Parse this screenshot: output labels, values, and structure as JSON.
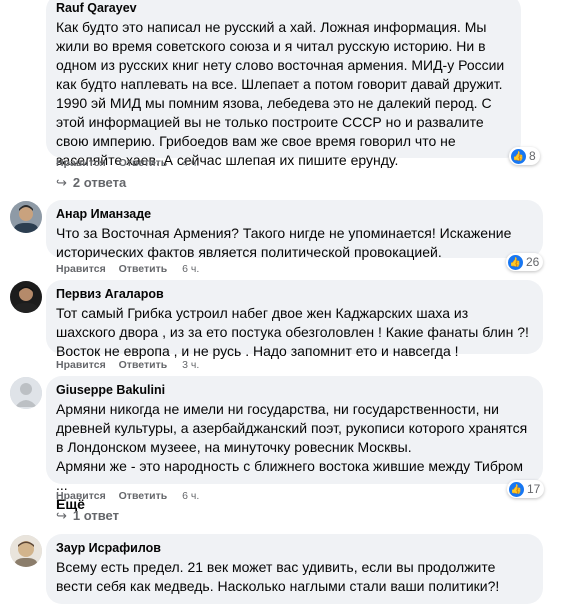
{
  "comments": [
    {
      "author": "Rauf Qarayev",
      "text": "Как будто это написал не русский а хай. Ложная информация. Мы жили во время советского союза и я читал русскую историю. Ни в одном из русских книг нету слово восточная армения. МИД-у России как будто наплевать на все. Шлепает а потом говорит давай дружит. 1990 эй МИД мы помним язова, лебедева это не далекий перод. С этой информацией вы не только построите СССР но и развалите свою империю. Грибоедов вам же свое время говорил что не заселяйте хаев. А сейчас шлепая их пишите ерунду.",
      "like_label": "Нравится",
      "reply_label": "Ответить",
      "time": "4 ч.",
      "reactions": "8",
      "replies": "2 ответа"
    },
    {
      "author": "Анар Иманзаде",
      "text": "Что за Восточная Армения? Такого нигде не упоминается! Искажение исторических фактов является политической провокацией.",
      "like_label": "Нравится",
      "reply_label": "Ответить",
      "time": "6 ч.",
      "reactions": "26"
    },
    {
      "author": "Первиз Агаларов",
      "text": "Тот самый Грибка устроил набег двое жен Каджарских шаха из шахского двора , из за ето постука обезголовлен ! Какие фанаты блин ?!\nВосток не европа , и не русь . Надо запомнит ето и навсегда !",
      "like_label": "Нравится",
      "reply_label": "Ответить",
      "time": "3 ч."
    },
    {
      "author": "Giuseppe Bakulini",
      "text": "Армяни никогда не имели ни государства, ни государственности, ни древней культуры, а азербайджанский поэт, рукописи которого хранятся в Лондонском музеее, на минуточку ровесник Москвы.\nАрмяни же - это народность с ближнего востока жившие между Тибром ...",
      "more": "Ещё",
      "like_label": "Нравится",
      "reply_label": "Ответить",
      "time": "6 ч.",
      "reactions": "17",
      "replies": "1 ответ"
    },
    {
      "author": "Заур Исрафилов",
      "text": "Всему есть предел. 21 век может вас удивить, если вы продолжите вести себя как медведь. Насколько наглыми стали ваши политики?!"
    }
  ],
  "icons": {
    "like": "thumbs-up-icon",
    "reply_arrow": "reply-arrow-icon"
  },
  "colors": {
    "bubble": "#f0f2f5",
    "like_blue": "#1877f2",
    "meta": "#65676b"
  }
}
